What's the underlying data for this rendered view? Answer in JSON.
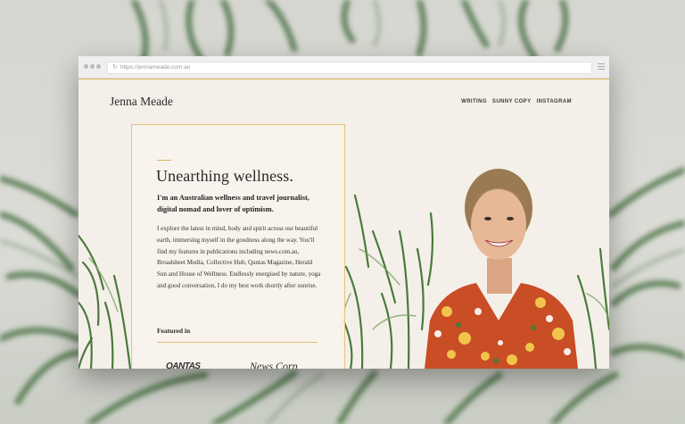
{
  "browser": {
    "url": "https://jennameade.com.au"
  },
  "site": {
    "logo": "Jenna Meade",
    "nav": [
      "WRITING",
      "SUNNY COPY",
      "INSTAGRAM"
    ],
    "heading": "Unearthing wellness.",
    "intro": "I'm an Australian wellness and travel journalist, digital nomad and lover of optimism.",
    "body": "I explore the latest in mind, body and spirit across our beautiful earth, immersing myself in the goodness along the way. You'll find my features in publications including news.com.au, Broadsheet Media, Collective Hub, Qantas Magazine, Herald Sun and House of Wellness. Endlessly energised by nature, yoga and good conversation, I do my best work shortly after sunrise.",
    "featured_label": "Featured in",
    "featured_logos": [
      "QANTAS",
      "News Corp"
    ]
  },
  "colors": {
    "accent": "#e6b24f",
    "page_bg": "#f4f0e9"
  },
  "icons": [
    "refresh-icon",
    "menu-icon"
  ]
}
